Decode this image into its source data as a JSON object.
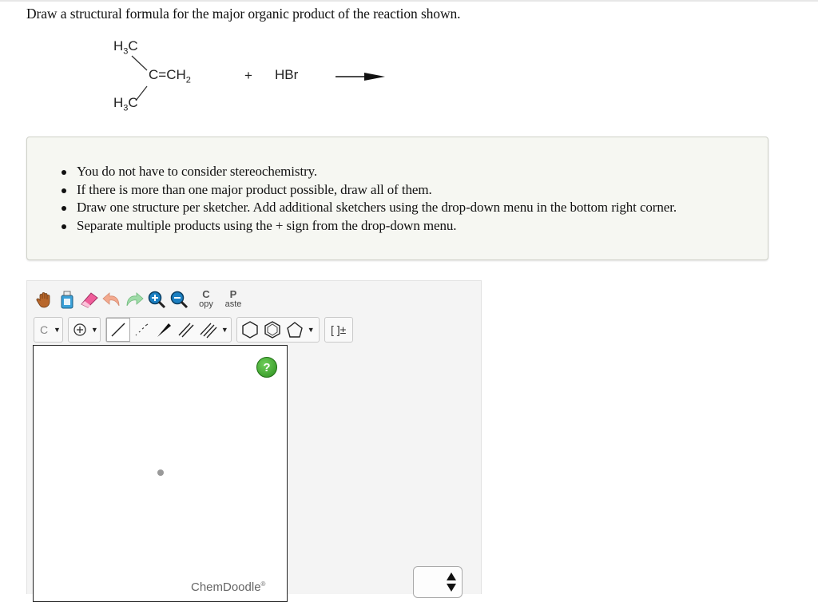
{
  "question": {
    "text": "Draw a structural formula for the major organic product of the reaction shown."
  },
  "reaction": {
    "methyl_top": "H3C",
    "methyl_bottom": "H3C",
    "carbon": "C",
    "double_bond": "=",
    "ch2": "CH2",
    "plus": "+",
    "reagent": "HBr"
  },
  "instructions": {
    "items": [
      "You do not have to consider stereochemistry.",
      "If there is more than one major product possible, draw all of them.",
      "Draw one structure per sketcher. Add additional sketchers using the drop-down menu in the bottom right corner.",
      "Separate multiple products using the + sign from the drop-down menu."
    ]
  },
  "sketcher": {
    "copy_letter": "C",
    "copy_rest": "opy",
    "paste_letter": "P",
    "paste_rest": "aste",
    "atom_label": "C",
    "bracket_label": "[ ]±",
    "help_label": "?",
    "brand": "ChemDoodle",
    "brand_mark": "®"
  }
}
